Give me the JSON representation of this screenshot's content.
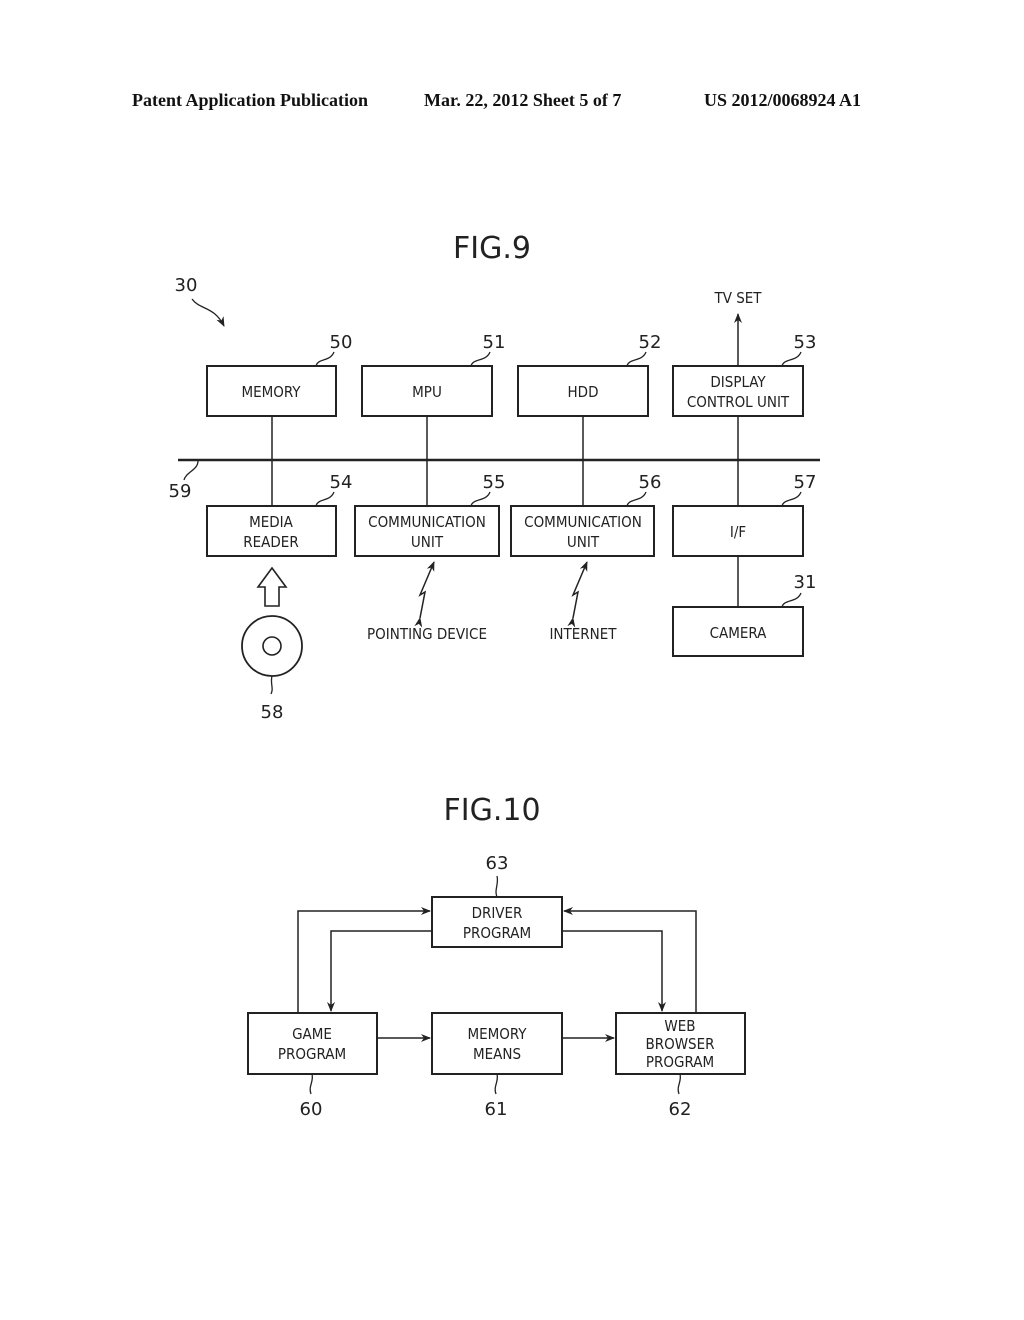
{
  "header": {
    "publication": "Patent Application Publication",
    "date_sheet": "Mar. 22, 2012  Sheet 5 of 7",
    "patent_number": "US 2012/0068924 A1"
  },
  "fig9": {
    "title": "FIG.9",
    "system_ref": "30",
    "bus_ref": "59",
    "tv_set": "TV SET",
    "pointing_device": "POINTING DEVICE",
    "internet": "INTERNET",
    "disc_ref": "58",
    "blocks": [
      {
        "id": "memory",
        "ref": "50",
        "lines": [
          "MEMORY"
        ]
      },
      {
        "id": "mpu",
        "ref": "51",
        "lines": [
          "MPU"
        ]
      },
      {
        "id": "hdd",
        "ref": "52",
        "lines": [
          "HDD"
        ]
      },
      {
        "id": "display-control-unit",
        "ref": "53",
        "lines": [
          "DISPLAY",
          "CONTROL UNIT"
        ]
      },
      {
        "id": "media-reader",
        "ref": "54",
        "lines": [
          "MEDIA",
          "READER"
        ]
      },
      {
        "id": "communication-unit-55",
        "ref": "55",
        "lines": [
          "COMMUNICATION",
          "UNIT"
        ]
      },
      {
        "id": "communication-unit-56",
        "ref": "56",
        "lines": [
          "COMMUNICATION",
          "UNIT"
        ]
      },
      {
        "id": "interface",
        "ref": "57",
        "lines": [
          "I/F"
        ]
      },
      {
        "id": "camera",
        "ref": "31",
        "lines": [
          "CAMERA"
        ]
      }
    ]
  },
  "fig10": {
    "title": "FIG.10",
    "blocks": [
      {
        "id": "driver-program",
        "ref": "63",
        "lines": [
          "DRIVER",
          "PROGRAM"
        ]
      },
      {
        "id": "game-program",
        "ref": "60",
        "lines": [
          "GAME",
          "PROGRAM"
        ]
      },
      {
        "id": "memory-means",
        "ref": "61",
        "lines": [
          "MEMORY",
          "MEANS"
        ]
      },
      {
        "id": "web-browser-program",
        "ref": "62",
        "lines": [
          "WEB",
          "BROWSER",
          "PROGRAM"
        ]
      }
    ]
  }
}
